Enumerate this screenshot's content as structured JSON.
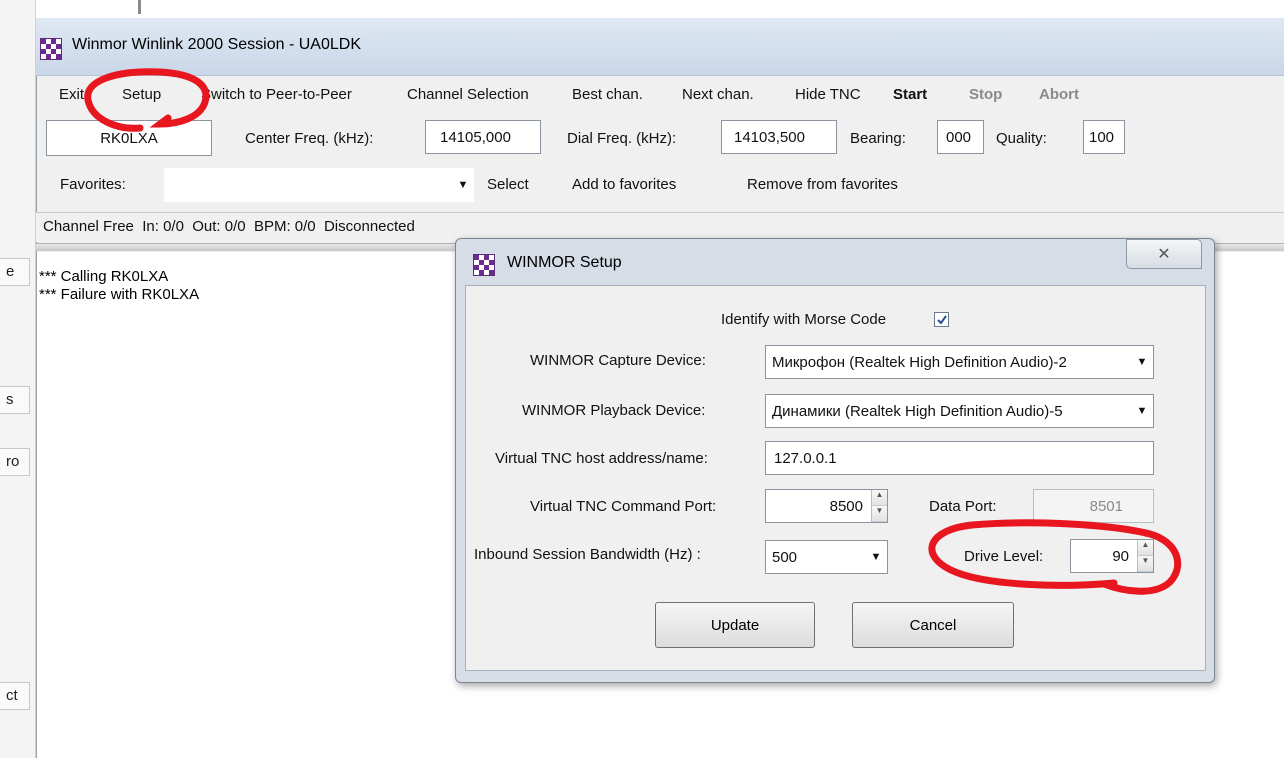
{
  "background": {
    "fragments": [
      "e",
      "s",
      "ro",
      "ct"
    ]
  },
  "window": {
    "title": "Winmor Winlink 2000 Session - UA0LDK"
  },
  "menu": {
    "exit": "Exit",
    "setup": "Setup",
    "switch": "Switch to Peer-to-Peer",
    "channel_selection": "Channel Selection",
    "best_chan": "Best chan.",
    "next_chan": "Next chan.",
    "hide_tnc": "Hide TNC",
    "start": "Start",
    "stop": "Stop",
    "abort": "Abort"
  },
  "station": {
    "callsign": "RK0LXA",
    "center_freq_label": "Center Freq. (kHz):",
    "center_freq": "14105,000",
    "dial_freq_label": "Dial Freq. (kHz):",
    "dial_freq": "14103,500",
    "bearing_label": "Bearing:",
    "bearing": "000",
    "quality_label": "Quality:",
    "quality": "100"
  },
  "favorites": {
    "label": "Favorites:",
    "value": "",
    "select": "Select",
    "add": "Add to favorites",
    "remove": "Remove from favorites"
  },
  "status": {
    "text": "Channel Free  In: 0/0  Out: 0/0  BPM: 0/0  Disconnected"
  },
  "log": {
    "lines": [
      "*** Calling RK0LXA",
      "*** Failure with RK0LXA"
    ]
  },
  "dialog": {
    "title": "WINMOR Setup",
    "identify_label": "Identify with Morse Code",
    "identify_checked": true,
    "capture_label": "WINMOR Capture Device:",
    "capture_value": "Микрофон (Realtek High Definition Audio)-2",
    "playback_label": "WINMOR Playback Device:",
    "playback_value": "Динамики (Realtek High Definition Audio)-5",
    "host_label": "Virtual TNC host address/name:",
    "host_value": "127.0.0.1",
    "cmd_port_label": "Virtual TNC Command Port:",
    "cmd_port_value": "8500",
    "data_port_label": "Data Port:",
    "data_port_value": "8501",
    "bandwidth_label": "Inbound Session Bandwidth (Hz) :",
    "bandwidth_value": "500",
    "drive_level_label": "Drive Level:",
    "drive_level_value": "90",
    "update_button": "Update",
    "cancel_button": "Cancel"
  },
  "colors": {
    "annotation_red": "#e8161f",
    "icon_purple": "#6b2a8f"
  }
}
